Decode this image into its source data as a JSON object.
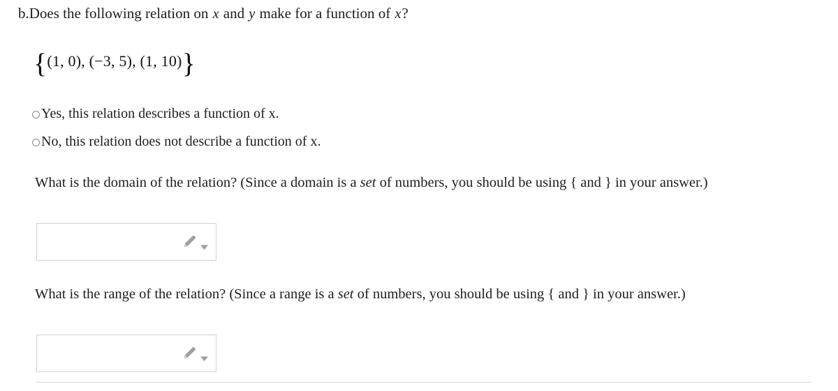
{
  "question": {
    "label": "b.",
    "stem_part1": "Does the following relation on ",
    "stem_var_x": "x",
    "stem_part2": " and ",
    "stem_var_y": "y",
    "stem_part3": " make for a function of ",
    "stem_var_x2": "x",
    "stem_part4": "?"
  },
  "relation": {
    "open_brace": "{",
    "elements": "(1, 0), (−3, 5), (1, 10)",
    "close_brace": "}"
  },
  "choices": [
    {
      "id": "yes",
      "label": "Yes, this relation describes a function of x."
    },
    {
      "id": "no",
      "label": "No, this relation does not describe a function of x."
    }
  ],
  "domain_question": {
    "text_before_italic": "What is the domain of the relation? (Since a domain is a ",
    "italic_word": "set",
    "text_after_italic": " of numbers, you should be using { and } in your answer.)"
  },
  "range_question": {
    "text_before_italic": "What is the range of the relation? (Since a range is a ",
    "italic_word": "set",
    "text_after_italic": " of numbers, you should be using { and } in your answer.)"
  },
  "answers": {
    "domain": {
      "value": "",
      "placeholder": ""
    },
    "range": {
      "value": "",
      "placeholder": ""
    }
  },
  "icons": {
    "pencil": "pencil-icon",
    "caret": "chevron-down-icon"
  },
  "colors": {
    "text": "#1d1d1d",
    "input_border": "#cfd2d4",
    "icon_gray": "#9aa0a6",
    "divider": "#d5d8dc",
    "radio_border": "#8a8a8a"
  }
}
